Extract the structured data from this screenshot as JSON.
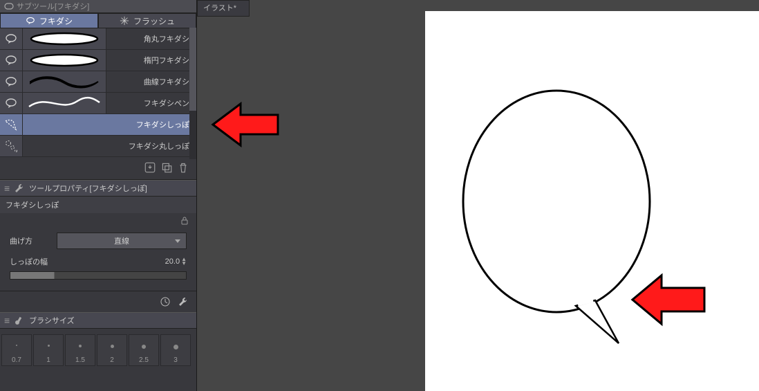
{
  "crumb": "サブツール[フキダシ]",
  "tabs": {
    "balloon": "フキダシ",
    "flash": "フラッシュ"
  },
  "tools": [
    {
      "label": "角丸フキダシ",
      "type": "rounded"
    },
    {
      "label": "楕円フキダシ",
      "type": "ellipse"
    },
    {
      "label": "曲線フキダシ",
      "type": "curve"
    },
    {
      "label": "フキダシペン",
      "type": "pen"
    },
    {
      "label": "フキダシしっぽ",
      "type": "tail",
      "selected": true
    },
    {
      "label": "フキダシ丸しっぽ",
      "type": "roundtail"
    }
  ],
  "property_panel": {
    "title": "ツールプロパティ[フキダシしっぽ]",
    "name": "フキダシしっぽ",
    "bend_label": "曲げ方",
    "bend_value": "直線",
    "tail_width_label": "しっぽの幅",
    "tail_width_value": "20.0"
  },
  "brush_panel": {
    "title": "ブラシサイズ"
  },
  "brush_sizes": [
    "0.7",
    "1",
    "1.5",
    "2",
    "2.5",
    "3"
  ],
  "doc_tab": "イラスト*"
}
